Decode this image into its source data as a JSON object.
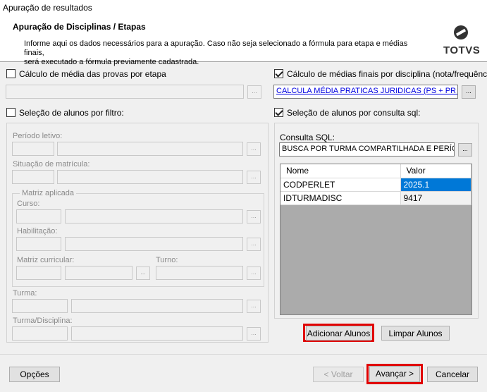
{
  "window": {
    "title": "Apuração de resultados"
  },
  "header": {
    "title": "Apuração de Disciplinas / Etapas",
    "description_line1": "Informe aqui os dados necessários para a apuração. Caso não seja selecionado a fórmula para etapa e médias finais,",
    "description_line2": "será executado a fórmula previamente cadastrada.",
    "logo_text": "TOTVS"
  },
  "left": {
    "calc_media_provas": {
      "label": "Cálculo de média das provas por etapa",
      "checked": false
    },
    "selecao_filtro": {
      "label": "Seleção de alunos por filtro:",
      "checked": false
    },
    "periodo_letivo_label": "Período letivo:",
    "situacao_matricula_label": "Situação de matrícula:",
    "matriz_aplicada_label": "Matriz aplicada",
    "curso_label": "Curso:",
    "habilitacao_label": "Habilitação:",
    "matriz_curricular_label": "Matriz curricular:",
    "turno_label": "Turno:",
    "turma_label": "Turma:",
    "turma_disciplina_label": "Turma/Disciplina:"
  },
  "right": {
    "calc_medias_finais": {
      "label": "Cálculo de médias finais por disciplina (nota/frequência)",
      "checked": true
    },
    "formula_value": "CALCULA MÉDIA PRATICAS JURIDICAS (PS + PR + PF)",
    "selecao_sql": {
      "label": "Seleção de alunos por consulta sql:",
      "checked": true
    },
    "consulta_sql_label": "Consulta SQL:",
    "consulta_sql_value": "BUSCA POR TURMA COMPARTILHADA E PERÍODO",
    "grid": {
      "columns": [
        "Nome",
        "Valor"
      ],
      "rows": [
        {
          "nome": "CODPERLET",
          "valor": "2025.1"
        },
        {
          "nome": "IDTURMADISC",
          "valor": "9417"
        }
      ]
    },
    "adicionar_label": "Adicionar Alunos",
    "limpar_label": "Limpar Alunos"
  },
  "footer": {
    "opcoes_label": "Opções",
    "voltar_label": "< Voltar",
    "avancar_label": "Avançar >",
    "cancelar_label": "Cancelar"
  },
  "dots_label": "...",
  "colors": {
    "highlight": "#e00000",
    "selection": "#0078d7",
    "link": "#0000e0"
  }
}
